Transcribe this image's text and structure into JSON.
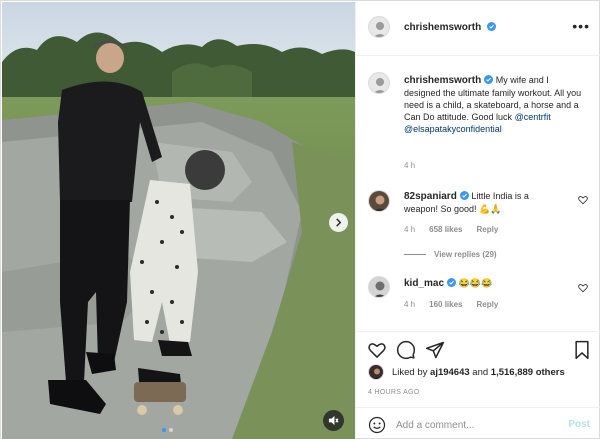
{
  "post": {
    "author": "chrishemsworth",
    "more_label": "•••",
    "media": {
      "slide_count": 2,
      "active_slide": 1,
      "icons": {
        "next": "chevron-right-icon",
        "mute": "speaker-muted-icon"
      }
    }
  },
  "caption": {
    "username": "chrishemsworth",
    "text": "My wife and I designed the ultimate family workout. All you need is a child, a skateboard, a horse and a Can Do attitude. Good luck",
    "mentions": [
      "@centrfit",
      "@elsapatakyconfidential"
    ],
    "time": "4 h"
  },
  "comments": [
    {
      "username": "82spaniard",
      "text": "Little India is a weapon! So good! 💪🙏",
      "time": "4 h",
      "likes": "658 likes",
      "reply_label": "Reply"
    },
    {
      "username": "kid_mac",
      "text": "😂😂😂",
      "time": "4 h",
      "likes": "160 likes",
      "reply_label": "Reply"
    }
  ],
  "view_replies": "View replies (29)",
  "likes_summary": {
    "prefix": "Liked by",
    "user": "aj194643",
    "joiner": "and",
    "count": "1,516,889 others"
  },
  "timestamp": "4 HOURS AGO",
  "comment_box": {
    "placeholder": "Add a comment...",
    "post_label": "Post",
    "emoji_icon": "smiley-icon"
  },
  "colors": {
    "verified": "#3897f0",
    "link": "#00376b",
    "muted": "#8e8e8e",
    "post_disabled": "#b2dffc"
  }
}
